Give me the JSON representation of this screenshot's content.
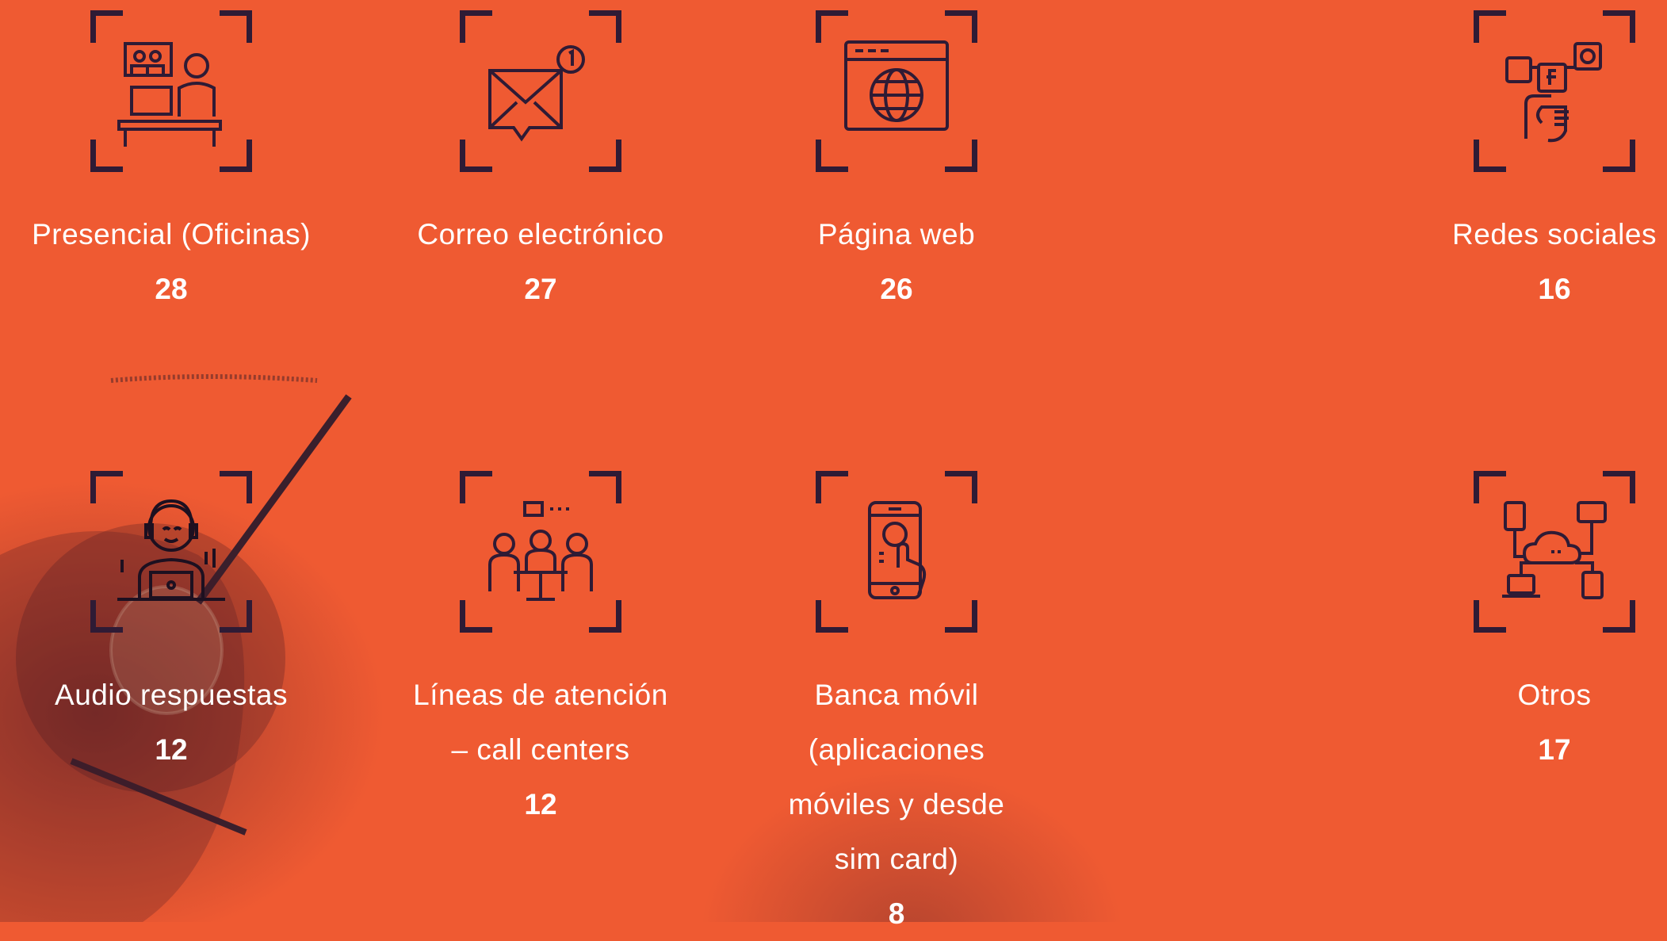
{
  "colors": {
    "background": "#ef5a32",
    "icon": "#2f1b35",
    "text": "#ffffff"
  },
  "channels": [
    {
      "label": "Presencial (Oficinas)",
      "value": "28",
      "icon": "office-desk-icon"
    },
    {
      "label": "Correo electrónico",
      "value": "27",
      "icon": "email-notification-icon"
    },
    {
      "label": "Página web",
      "value": "26",
      "icon": "web-page-globe-icon"
    },
    {
      "label": "Redes sociales",
      "value": "16",
      "icon": "social-media-icon"
    },
    {
      "label": "Audio respuestas",
      "value": "12",
      "icon": "call-operator-icon"
    },
    {
      "label": "Líneas de atención – call centers",
      "value": "12",
      "icon": "meeting-team-icon"
    },
    {
      "label": "Banca móvil (aplicaciones móviles y desde sim card)",
      "value": "8",
      "icon": "mobile-phone-icon"
    },
    {
      "label": "Otros",
      "value": "17",
      "icon": "cloud-network-icon"
    }
  ]
}
